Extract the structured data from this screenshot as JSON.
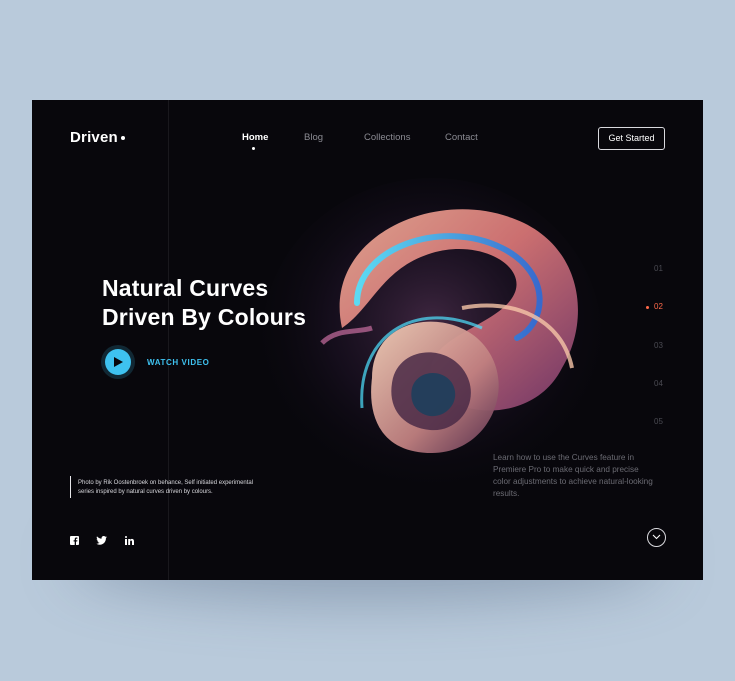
{
  "brand": {
    "name": "Driven"
  },
  "nav": {
    "items": [
      {
        "label": "Home",
        "active": true
      },
      {
        "label": "Blog",
        "active": false
      },
      {
        "label": "Collections",
        "active": false
      },
      {
        "label": "Contact",
        "active": false
      }
    ],
    "cta_label": "Get Started"
  },
  "hero": {
    "headline_line1": "Natural Curves",
    "headline_line2": "Driven By Colours",
    "watch_label": "WATCH VIDEO",
    "credit": "Photo by Rik Oostenbroek on behance, Self initiated experimental series inspired by natural curves driven by colours.",
    "description": "Learn how to use the Curves feature in Premiere Pro to make quick and precise color adjustments to achieve natural-looking results."
  },
  "pager": {
    "items": [
      "01",
      "02",
      "03",
      "04",
      "05"
    ],
    "active": "02"
  },
  "social": {
    "icons": [
      "facebook-icon",
      "twitter-icon",
      "linkedin-icon"
    ]
  },
  "colors": {
    "accent_blue": "#3ec2f0",
    "accent_orange": "#ff6a4a",
    "background": "#08070c",
    "page_bg": "#b9cadb"
  }
}
